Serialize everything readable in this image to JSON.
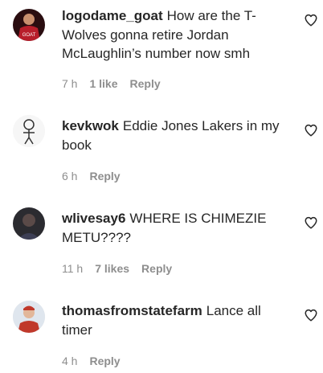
{
  "comments": [
    {
      "username": "logodame_goat",
      "text": "How are the T-Wolves gonna retire Jordan McLaughlin’s number now smh",
      "time": "7 h",
      "likes": "1 like",
      "reply": "Reply",
      "avatar_icon": "avatar-red-jersey"
    },
    {
      "username": "kevkwok",
      "text": "Eddie Jones Lakers in my book",
      "time": "6 h",
      "likes": "",
      "reply": "Reply",
      "avatar_icon": "avatar-sketch-figure"
    },
    {
      "username": "wlivesay6",
      "text": "WHERE IS CHIMEZIE METU????",
      "time": "11 h",
      "likes": "7 likes",
      "reply": "Reply",
      "avatar_icon": "avatar-dark-photo"
    },
    {
      "username": "thomasfromstatefarm",
      "text": "Lance all timer",
      "time": "4 h",
      "likes": "",
      "reply": "Reply",
      "avatar_icon": "avatar-red-shirt"
    }
  ],
  "colors": {
    "text": "#262626",
    "meta": "#8e8e8e"
  }
}
